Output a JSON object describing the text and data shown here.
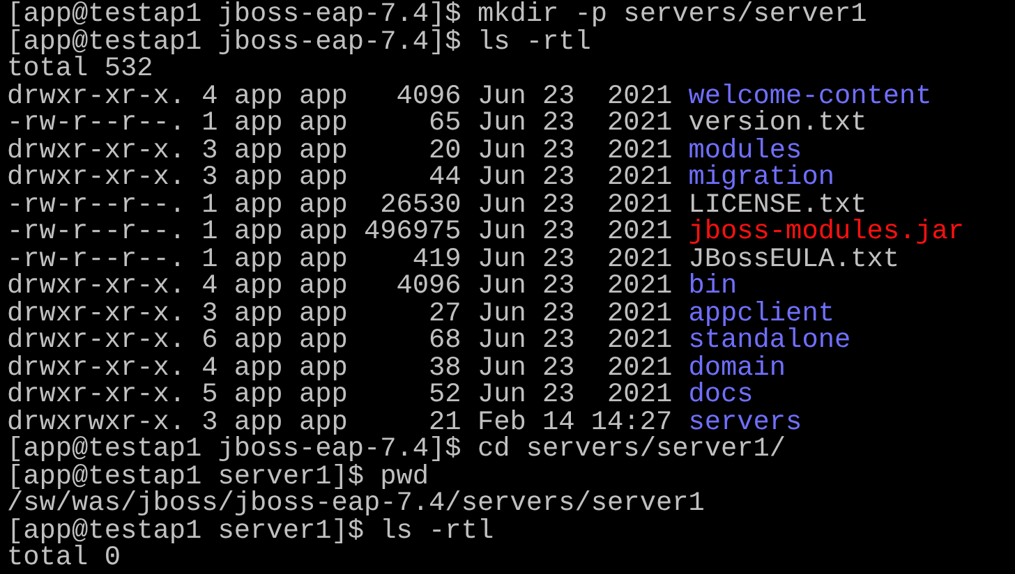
{
  "terminal": {
    "lines": [
      {
        "kind": "text",
        "text": "[app@testap1 jboss-eap-7.4]$ mkdir -p servers/server1"
      },
      {
        "kind": "text",
        "text": "[app@testap1 jboss-eap-7.4]$ ls -rtl"
      },
      {
        "kind": "text",
        "text": "total 532"
      },
      {
        "kind": "entry",
        "info": "drwxr-xr-x. 4 app app   4096 Jun 23  2021",
        "name": "welcome-content",
        "color": "#6f6fff"
      },
      {
        "kind": "entry",
        "info": "-rw-r--r--. 1 app app     65 Jun 23  2021",
        "name": "version.txt",
        "color": "#c0c0c0"
      },
      {
        "kind": "entry",
        "info": "drwxr-xr-x. 3 app app     20 Jun 23  2021",
        "name": "modules",
        "color": "#6f6fff"
      },
      {
        "kind": "entry",
        "info": "drwxr-xr-x. 3 app app     44 Jun 23  2021",
        "name": "migration",
        "color": "#6f6fff"
      },
      {
        "kind": "entry",
        "info": "-rw-r--r--. 1 app app  26530 Jun 23  2021",
        "name": "LICENSE.txt",
        "color": "#c0c0c0"
      },
      {
        "kind": "entry",
        "info": "-rw-r--r--. 1 app app 496975 Jun 23  2021",
        "name": "jboss-modules.jar",
        "color": "#ff1010"
      },
      {
        "kind": "entry",
        "info": "-rw-r--r--. 1 app app    419 Jun 23  2021",
        "name": "JBossEULA.txt",
        "color": "#c0c0c0"
      },
      {
        "kind": "entry",
        "info": "drwxr-xr-x. 4 app app   4096 Jun 23  2021",
        "name": "bin",
        "color": "#6f6fff"
      },
      {
        "kind": "entry",
        "info": "drwxr-xr-x. 3 app app     27 Jun 23  2021",
        "name": "appclient",
        "color": "#6f6fff"
      },
      {
        "kind": "entry",
        "info": "drwxr-xr-x. 6 app app     68 Jun 23  2021",
        "name": "standalone",
        "color": "#6f6fff"
      },
      {
        "kind": "entry",
        "info": "drwxr-xr-x. 4 app app     38 Jun 23  2021",
        "name": "domain",
        "color": "#6f6fff"
      },
      {
        "kind": "entry",
        "info": "drwxr-xr-x. 5 app app     52 Jun 23  2021",
        "name": "docs",
        "color": "#6f6fff"
      },
      {
        "kind": "entry",
        "info": "drwxrwxr-x. 3 app app     21 Feb 14 14:27",
        "name": "servers",
        "color": "#6f6fff"
      },
      {
        "kind": "text",
        "text": "[app@testap1 jboss-eap-7.4]$ cd servers/server1/"
      },
      {
        "kind": "text",
        "text": "[app@testap1 server1]$ pwd"
      },
      {
        "kind": "text",
        "text": "/sw/was/jboss/jboss-eap-7.4/servers/server1"
      },
      {
        "kind": "text",
        "text": "[app@testap1 server1]$ ls -rtl"
      },
      {
        "kind": "text",
        "text": "total 0"
      }
    ]
  }
}
